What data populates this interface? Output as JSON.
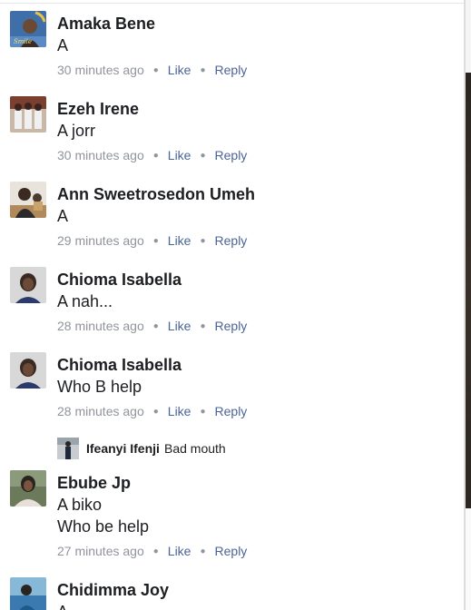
{
  "comments": [
    {
      "author": "Amaka Bene",
      "lines": [
        "A"
      ],
      "time": "30 minutes ago",
      "like": "Like",
      "reply": "Reply",
      "avatar_colors": [
        "#3f6fa8",
        "#e6c24a"
      ]
    },
    {
      "author": "Ezeh Irene",
      "lines": [
        "A jorr"
      ],
      "time": "30 minutes ago",
      "like": "Like",
      "reply": "Reply",
      "avatar_colors": [
        "#7a3f2e",
        "#f0f0f0"
      ]
    },
    {
      "author": "Ann Sweetrosedon Umeh",
      "lines": [
        "A"
      ],
      "time": "29 minutes ago",
      "like": "Like",
      "reply": "Reply",
      "avatar_colors": [
        "#5a4a3a",
        "#c9a36b"
      ]
    },
    {
      "author": "Chioma Isabella",
      "lines": [
        "A nah..."
      ],
      "time": "28 minutes ago",
      "like": "Like",
      "reply": "Reply",
      "avatar_colors": [
        "#d8d8d8",
        "#3a2a22"
      ]
    },
    {
      "author": "Chioma Isabella",
      "lines": [
        "Who B help"
      ],
      "time": "28 minutes ago",
      "like": "Like",
      "reply": "Reply",
      "avatar_colors": [
        "#d8d8d8",
        "#3a2a22"
      ]
    },
    {
      "author": "Ebube Jp",
      "lines": [
        "A biko",
        "Who be help"
      ],
      "time": "27 minutes ago",
      "like": "Like",
      "reply": "Reply",
      "avatar_colors": [
        "#6a7a5a",
        "#2a2420"
      ]
    },
    {
      "author": "Chidimma Joy",
      "lines": [
        "A"
      ],
      "time": "",
      "like": "",
      "reply": "",
      "avatar_colors": [
        "#3a7ab0",
        "#88b8d8"
      ]
    }
  ],
  "nested_reply": {
    "author": "Ifeanyi Ifenji",
    "text": "Bad mouth"
  }
}
